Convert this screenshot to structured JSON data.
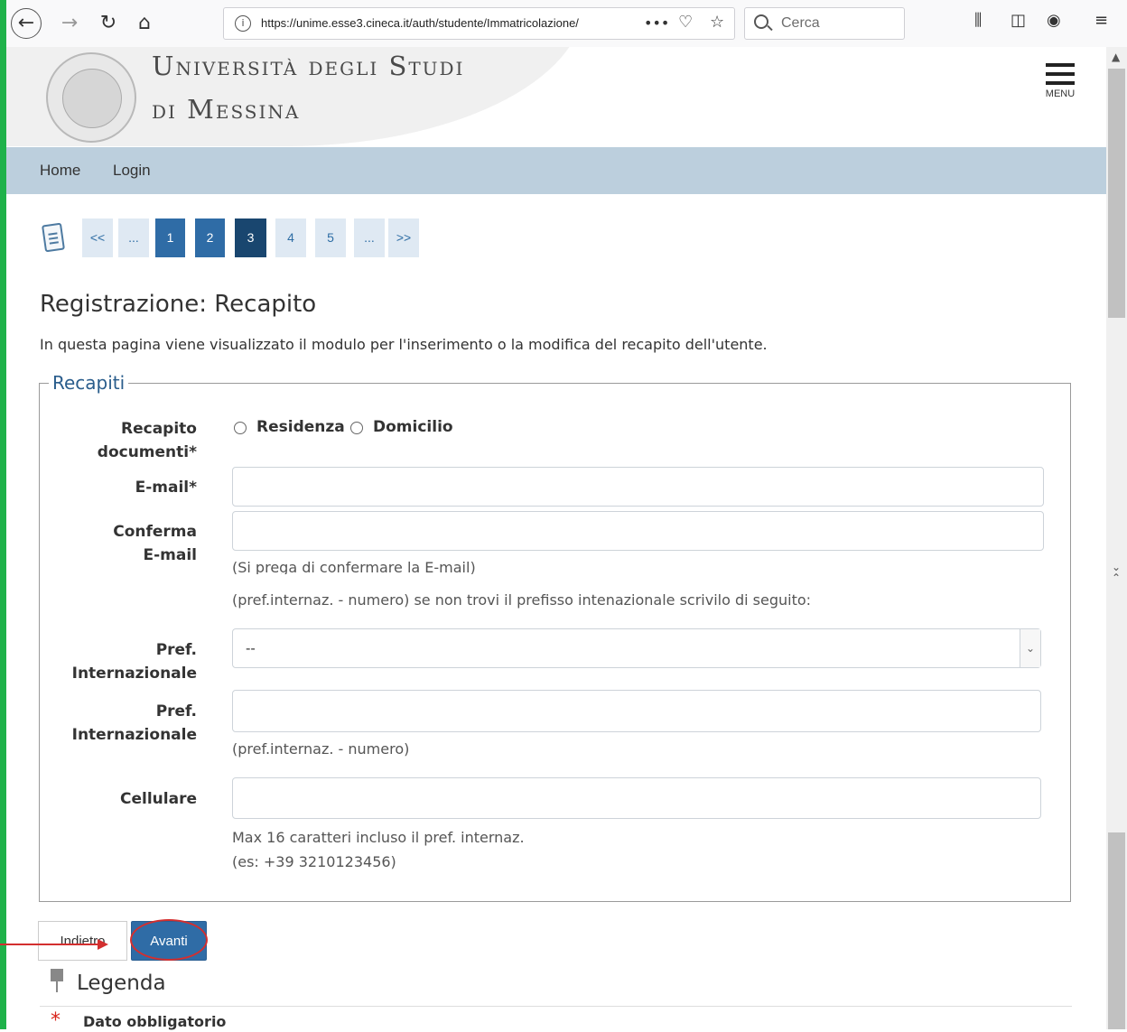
{
  "browser": {
    "url": "https://unime.esse3.cineca.it/auth/studente/Immatricolazione/",
    "search_placeholder": "Cerca",
    "more_label": "•••"
  },
  "header": {
    "university_line1": "Università degli Studi",
    "university_line2": "di Messina",
    "menu_label": "MENU"
  },
  "nav": {
    "items": [
      {
        "label": "Home"
      },
      {
        "label": "Login"
      }
    ]
  },
  "pagination": {
    "first": "<<",
    "ellipsis_left": "...",
    "pages": [
      "1",
      "2",
      "3",
      "4",
      "5"
    ],
    "current": "3",
    "ellipsis_right": "...",
    "last": ">>"
  },
  "page": {
    "title": "Registrazione: Recapito",
    "description": "In questa pagina viene visualizzato il modulo per l'inserimento o la modifica del recapito dell'utente."
  },
  "form": {
    "legend": "Recapiti",
    "recapito_label_1": "Recapito",
    "recapito_label_2": "documenti*",
    "radio_residenza": "Residenza",
    "radio_domicilio": "Domicilio",
    "email_label": "E-mail*",
    "email_value": "",
    "confirm_label_1": "Conferma",
    "confirm_label_2": "E-mail",
    "confirm_value": "",
    "confirm_help": "(Si prega di confermare la E-mail)",
    "pref_intro": "(pref.internaz. - numero) se non trovi il prefisso intenazionale scrivilo di seguito:",
    "pref_select_label_1": "Pref.",
    "pref_select_label_2": "Internazionale",
    "pref_select_value": "--",
    "pref_text_label_1": "Pref.",
    "pref_text_label_2": "Internazionale",
    "pref_text_value": "",
    "pref_text_help": "(pref.internaz. - numero)",
    "cellulare_label": "Cellulare",
    "cellulare_value": "",
    "cellulare_help_1": "Max 16 caratteri incluso il pref. internaz.",
    "cellulare_help_2": "(es: +39 3210123456)"
  },
  "buttons": {
    "back": "Indietro",
    "next": "Avanti"
  },
  "legenda": {
    "title": "Legenda",
    "mandatory": "Dato obbligatorio"
  },
  "colors": {
    "accent": "#2f6ca6",
    "nav_bg": "#bccfdd",
    "annotation": "#d32f2f",
    "side_bar": "#1fb24a"
  }
}
